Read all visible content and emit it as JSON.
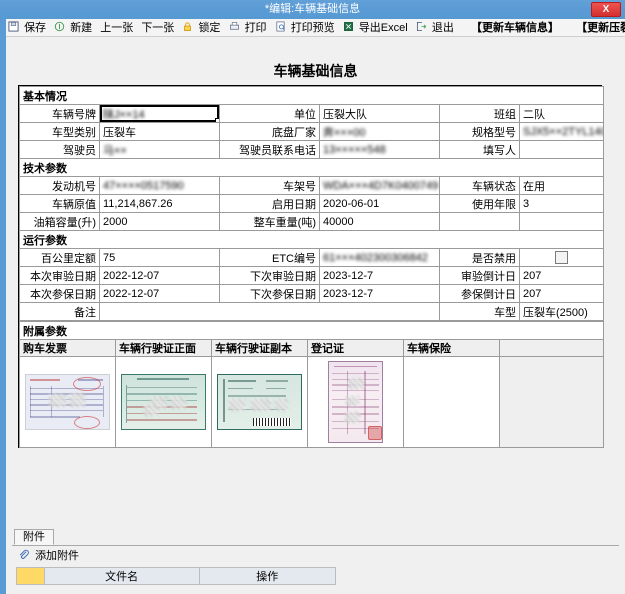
{
  "window": {
    "title": "*编辑:车辆基础信息",
    "close_label": "X",
    "titlebar_color": "#5b9bd5",
    "close_color": "#d32f2f"
  },
  "toolbar": {
    "items": [
      {
        "label": "保存",
        "icon": "save-icon"
      },
      {
        "label": "新建",
        "icon": "new-icon"
      },
      {
        "label": "上一张",
        "icon": "none"
      },
      {
        "label": "下一张",
        "icon": "none"
      },
      {
        "label": "锁定",
        "icon": "lock-icon"
      },
      {
        "label": "打印",
        "icon": "print-icon"
      },
      {
        "label": "打印预览",
        "icon": "print-preview-icon"
      },
      {
        "label": "导出Excel",
        "icon": "excel-icon"
      },
      {
        "label": "退出",
        "icon": "exit-icon"
      }
    ],
    "plain_buttons": [
      {
        "label": "【更新车辆信息】"
      },
      {
        "label": "【更新压裂车辆信息】"
      }
    ]
  },
  "page_title": "车辆基础信息",
  "sections": {
    "basic": {
      "title": "基本情况",
      "rows": [
        [
          {
            "label": "车辆号牌",
            "value": "陕J××14",
            "redacted": true,
            "focused": true
          },
          {
            "label": "单位",
            "value": "压裂大队",
            "redacted": false
          },
          {
            "label": "班组",
            "value": "二队",
            "redacted": false
          }
        ],
        [
          {
            "label": "车型类别",
            "value": "压裂车",
            "redacted": false
          },
          {
            "label": "底盘厂家",
            "value": "奔×××00",
            "redacted": true
          },
          {
            "label": "规格型号",
            "value": "SJX5××2TYL140",
            "redacted": true
          }
        ],
        [
          {
            "label": "驾驶员",
            "value": "马××",
            "redacted": true
          },
          {
            "label": "驾驶员联系电话",
            "value": "13×××××548",
            "redacted": true
          },
          {
            "label": "填写人",
            "value": "",
            "redacted": false
          }
        ]
      ]
    },
    "technical": {
      "title": "技术参数",
      "rows": [
        [
          {
            "label": "发动机号",
            "value": "47××××0517590",
            "redacted": true
          },
          {
            "label": "车架号",
            "value": "WDA×××4D7K0400749",
            "redacted": true
          },
          {
            "label": "车辆状态",
            "value": "在用",
            "redacted": false
          }
        ],
        [
          {
            "label": "车辆原值",
            "value": "11,214,867.26",
            "redacted": false
          },
          {
            "label": "启用日期",
            "value": "2020-06-01",
            "redacted": false
          },
          {
            "label": "使用年限",
            "value": "3",
            "redacted": false
          }
        ],
        [
          {
            "label": "油箱容量(升)",
            "value": "2000",
            "redacted": false
          },
          {
            "label": "整车重量(吨)",
            "value": "40000",
            "redacted": false
          },
          {
            "label": "",
            "value": "",
            "redacted": false
          }
        ]
      ]
    },
    "operation": {
      "title": "运行参数",
      "rows": [
        [
          {
            "label": "百公里定额",
            "value": "75",
            "redacted": false
          },
          {
            "label": "ETC编号",
            "value": "61×××402300306842",
            "redacted": true
          },
          {
            "label": "是否禁用",
            "value": "",
            "redacted": false,
            "checkbox": true,
            "checked": false
          }
        ],
        [
          {
            "label": "本次审验日期",
            "value": "2022-12-07",
            "redacted": false
          },
          {
            "label": "下次审验日期",
            "value": "2023-12-7",
            "redacted": false
          },
          {
            "label": "审验倒计日",
            "value": "207",
            "redacted": false
          }
        ],
        [
          {
            "label": "本次参保日期",
            "value": "2022-12-07",
            "redacted": false
          },
          {
            "label": "下次参保日期",
            "value": "2023-12-7",
            "redacted": false
          },
          {
            "label": "参保倒计日",
            "value": "207",
            "redacted": false
          }
        ]
      ],
      "remark": {
        "label": "备注",
        "value": ""
      },
      "vehicle_type": {
        "label": "车型",
        "value": "压裂车(2500)"
      }
    },
    "attachments_params": {
      "title": "附属参数",
      "columns": [
        {
          "label": "购车发票",
          "doc": "invoice"
        },
        {
          "label": "车辆行驶证正面",
          "doc": "license-front"
        },
        {
          "label": "车辆行驶证副本",
          "doc": "license-copy"
        },
        {
          "label": "登记证",
          "doc": "registration"
        },
        {
          "label": "车辆保险",
          "doc": "insurance"
        },
        {
          "label": "",
          "doc": "none"
        }
      ]
    }
  },
  "attachment_panel": {
    "tab_label": "附件",
    "add_label": "添加附件",
    "columns": [
      "",
      "文件名",
      "操作"
    ],
    "rows": []
  }
}
